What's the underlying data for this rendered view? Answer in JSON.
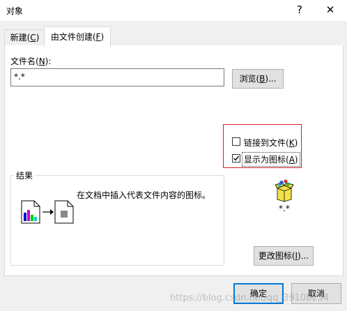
{
  "window": {
    "title": "对象",
    "help": "?",
    "close": "✕"
  },
  "tabs": [
    {
      "label_pre": "新建(",
      "key": "C",
      "label_post": ")"
    },
    {
      "label_pre": "由文件创建(",
      "key": "F",
      "label_post": ")"
    }
  ],
  "file": {
    "label_pre": "文件名(",
    "key": "N",
    "label_post": "):",
    "value": "*.*",
    "browse_pre": "浏览(",
    "browse_key": "B",
    "browse_post": ")..."
  },
  "options": {
    "link_pre": "链接到文件(",
    "link_key": "K",
    "link_post": ")",
    "link_checked": false,
    "icon_pre": "显示为图标(",
    "icon_key": "A",
    "icon_post": ")",
    "icon_checked": true
  },
  "result": {
    "group_label": "结果",
    "description": "在文档中插入代表文件内容的图标。"
  },
  "icon_caption": "*.*",
  "change_icon": {
    "pre": "更改图标(",
    "key": "I",
    "post": ")..."
  },
  "buttons": {
    "ok": "确定",
    "cancel": "取消"
  },
  "watermark": "https://blog.csdn.net/qq_39108254"
}
